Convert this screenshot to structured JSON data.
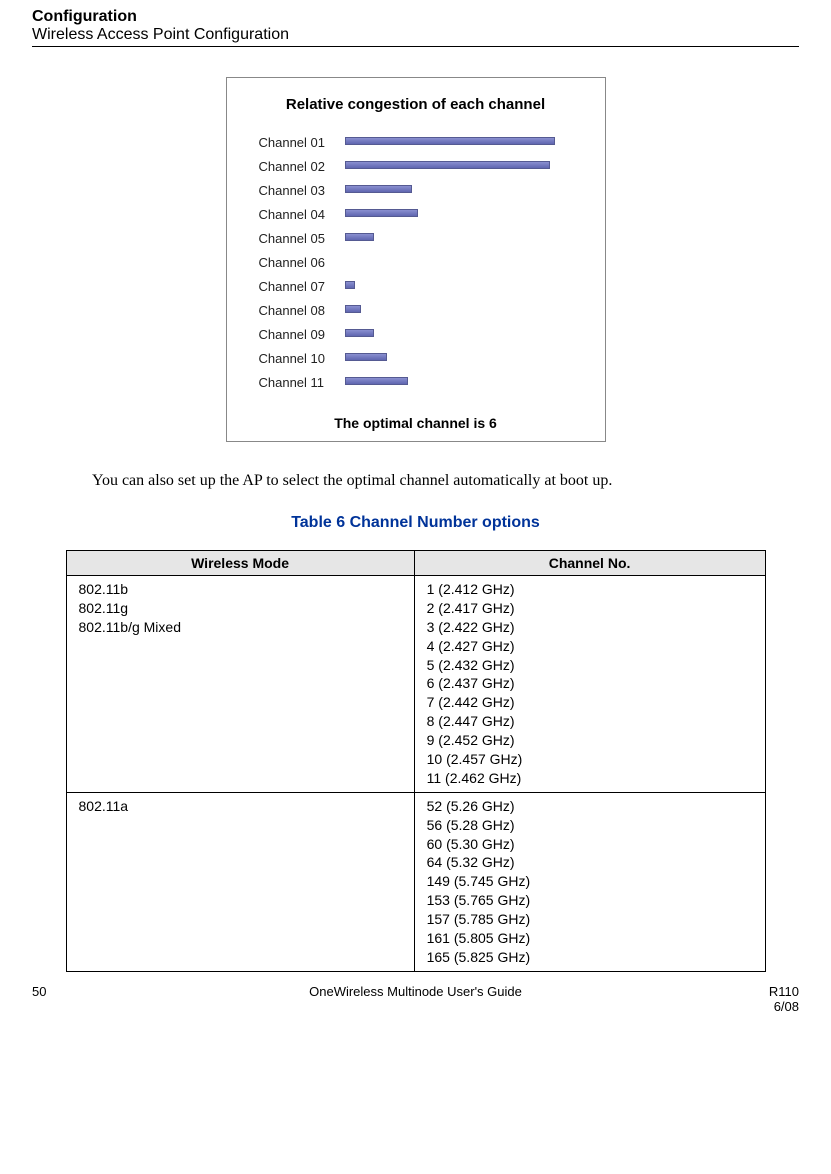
{
  "header": {
    "title": "Configuration",
    "subtitle": "Wireless Access Point Configuration"
  },
  "chart_data": {
    "type": "bar",
    "title": "Relative congestion of each channel",
    "categories": [
      "Channel 01",
      "Channel 02",
      "Channel 03",
      "Channel 04",
      "Channel 05",
      "Channel 06",
      "Channel 07",
      "Channel 08",
      "Channel 09",
      "Channel 10",
      "Channel 11"
    ],
    "values": [
      100,
      98,
      32,
      35,
      14,
      0,
      5,
      8,
      14,
      20,
      30
    ],
    "xlabel": "",
    "ylabel": "",
    "ylim": [
      0,
      100
    ],
    "footer": "The optimal channel is 6"
  },
  "body_text": "You can also set up the AP to select the optimal channel automatically at boot up.",
  "table": {
    "caption": "Table 6  Channel Number options",
    "headers": [
      "Wireless Mode",
      "Channel No."
    ],
    "rows": [
      {
        "mode": "802.11b\n802.11g\n802.11b/g Mixed",
        "channels": "1 (2.412 GHz)\n2 (2.417 GHz)\n3 (2.422 GHz)\n4 (2.427 GHz)\n5 (2.432 GHz)\n6 (2.437 GHz)\n7 (2.442 GHz)\n8 (2.447 GHz)\n9 (2.452 GHz)\n10 (2.457 GHz)\n11 (2.462 GHz)"
      },
      {
        "mode": "802.11a",
        "channels": "52 (5.26 GHz)\n56 (5.28 GHz)\n60 (5.30 GHz)\n64 (5.32 GHz)\n149 (5.745 GHz)\n153 (5.765 GHz)\n157 (5.785 GHz)\n161 (5.805 GHz)\n165 (5.825 GHz)"
      }
    ]
  },
  "footer": {
    "page": "50",
    "center": "OneWireless Multinode User's Guide",
    "right1": "R110",
    "right2": "6/08"
  }
}
